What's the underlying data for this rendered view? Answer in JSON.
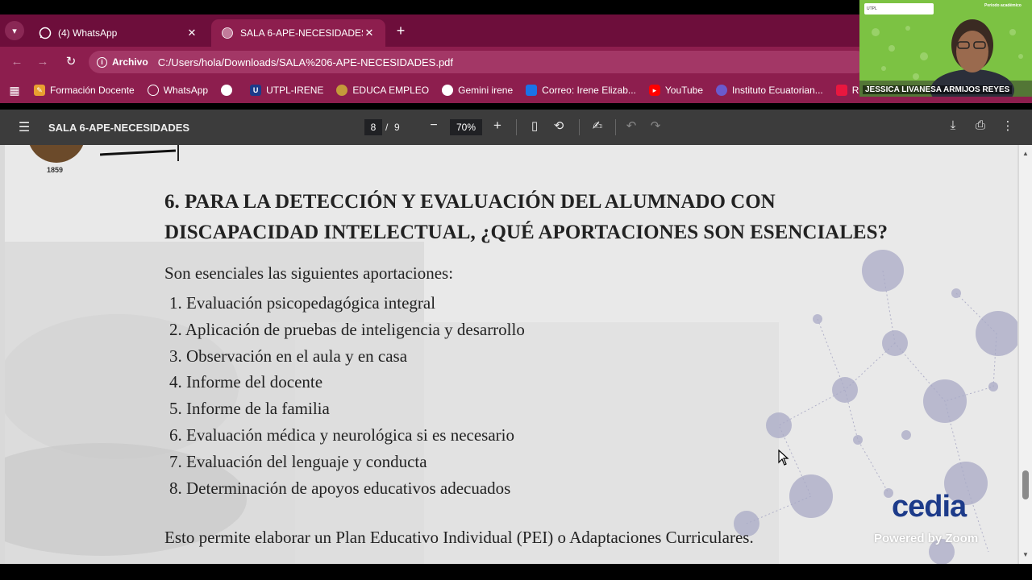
{
  "browser": {
    "tabs": [
      {
        "title": "(4) WhatsApp",
        "icon": "whatsapp-icon",
        "active": false
      },
      {
        "title": "SALA 6-APE-NECESIDADES",
        "icon": "globe-icon",
        "active": true
      }
    ],
    "address": {
      "chip": "Archivo",
      "url": "C:/Users/hola/Downloads/SALA%206-APE-NECESIDADES.pdf"
    },
    "bookmarks": [
      {
        "label": "Formación Docente",
        "icon": "pencil-icon",
        "color": "#e8a030"
      },
      {
        "label": "WhatsApp",
        "icon": "whatsapp-icon",
        "color": "#25d366"
      },
      {
        "label": "",
        "icon": "globe-icon",
        "color": "#ffffff"
      },
      {
        "label": "UTPL-IRENE",
        "icon": "utpl-icon",
        "color": "#1d3b8a",
        "glyph": "U"
      },
      {
        "label": "EDUCA EMPLEO",
        "icon": "crest-icon",
        "color": "#c49a3a"
      },
      {
        "label": "Gemini irene",
        "icon": "globe-icon",
        "color": "#ffffff"
      },
      {
        "label": "Correo: Irene Elizab...",
        "icon": "outlook-icon",
        "color": "#1a73e8"
      },
      {
        "label": "YouTube",
        "icon": "youtube-icon",
        "color": "#ff0000"
      },
      {
        "label": "Instituto Ecuatorian...",
        "icon": "crest-icon",
        "color": "#6a5acd"
      },
      {
        "label": "RUBRICA",
        "icon": "bookmark-icon",
        "color": "#e8173f"
      }
    ]
  },
  "pdf": {
    "title": "SALA 6-APE-NECESIDADES",
    "page_current": "8",
    "page_separator": "/",
    "page_total": "9",
    "zoom": "70%"
  },
  "content": {
    "seal_year": "1859",
    "heading_line1": "6. PARA LA DETECCIÓN Y EVALUACIÓN DEL ALUMNADO CON",
    "heading_line2": "DISCAPACIDAD INTELECTUAL, ¿QUÉ APORTACIONES SON ESENCIALES?",
    "intro": "Son esenciales las siguientes aportaciones:",
    "items": [
      "1. Evaluación psicopedagógica integral",
      "2. Aplicación de pruebas de inteligencia y desarrollo",
      "3. Observación en el aula y en casa",
      "4. Informe del docente",
      "5. Informe de la familia",
      "6. Evaluación médica y neurológica si es necesario",
      "7. Evaluación del lenguaje y conducta",
      "8. Determinación de apoyos educativos adecuados"
    ],
    "conclusion": "Esto permite elaborar un Plan Educativo Individual (PEI) o Adaptaciones Curriculares.",
    "brand": "cedia",
    "powered": "Powered by Zoom"
  },
  "video": {
    "presenter": "JESSICA LIVANESA ARMIJOS REYES",
    "header_text": "UTPL",
    "period_text": "Periodo académico"
  },
  "colors": {
    "tab_bar": "#6d0e3b",
    "toolbar": "#8d1e4e",
    "pdf_toolbar": "#3c3c3c",
    "cedia_blue": "#1d3b8a"
  }
}
